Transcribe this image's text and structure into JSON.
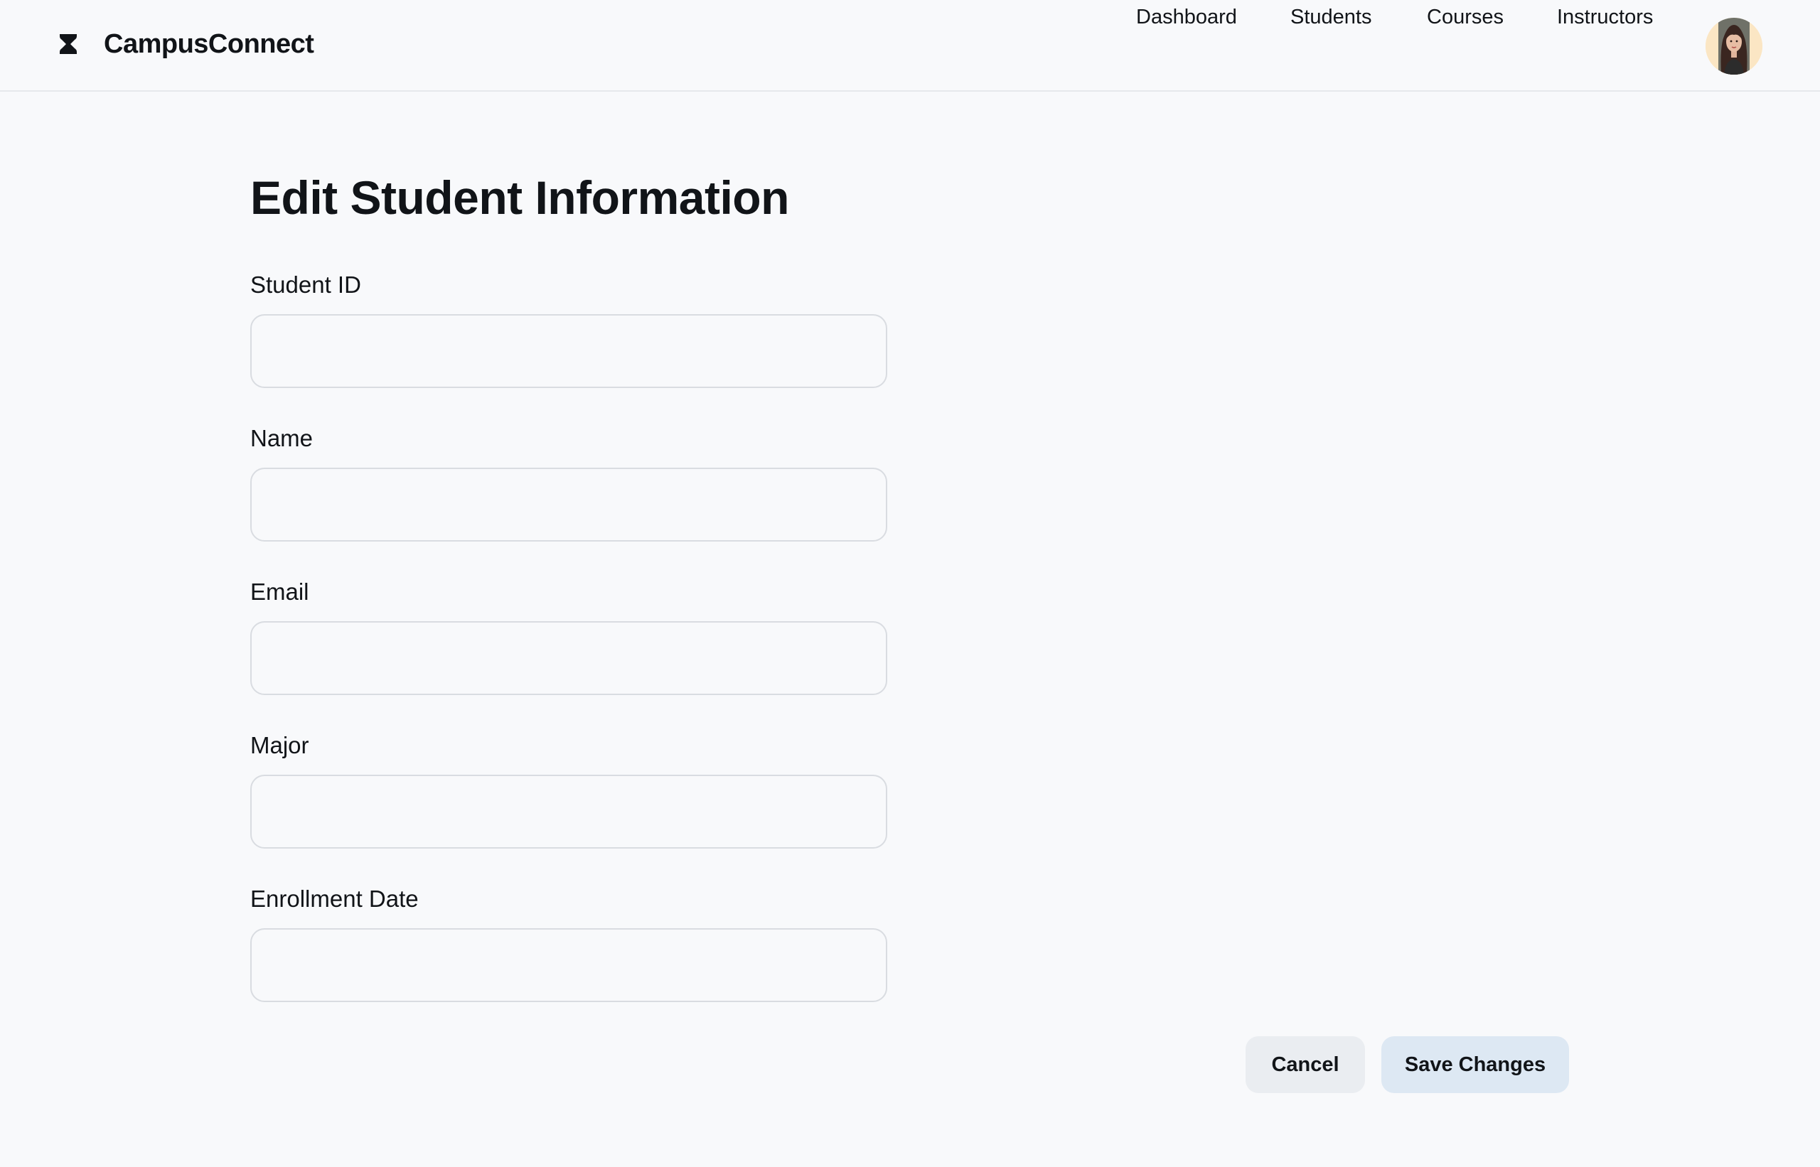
{
  "app": {
    "name": "CampusConnect",
    "logo_icon": "hourglass-logo-icon"
  },
  "nav": {
    "items": [
      {
        "label": "Dashboard"
      },
      {
        "label": "Students"
      },
      {
        "label": "Courses"
      },
      {
        "label": "Instructors"
      }
    ],
    "avatar_icon": "user-avatar"
  },
  "page": {
    "title": "Edit Student Information"
  },
  "form": {
    "fields": [
      {
        "label": "Student ID",
        "value": "",
        "placeholder": ""
      },
      {
        "label": "Name",
        "value": "",
        "placeholder": ""
      },
      {
        "label": "Email",
        "value": "",
        "placeholder": ""
      },
      {
        "label": "Major",
        "value": "",
        "placeholder": ""
      },
      {
        "label": "Enrollment Date",
        "value": "",
        "placeholder": ""
      }
    ],
    "cancel_label": "Cancel",
    "save_label": "Save Changes"
  },
  "colors": {
    "background": "#f8f9fb",
    "text": "#111418",
    "border": "#d9dce1",
    "cancel_bg": "#eaedf1",
    "save_bg": "#dde8f3",
    "avatar_bg": "#fbe6c4"
  }
}
